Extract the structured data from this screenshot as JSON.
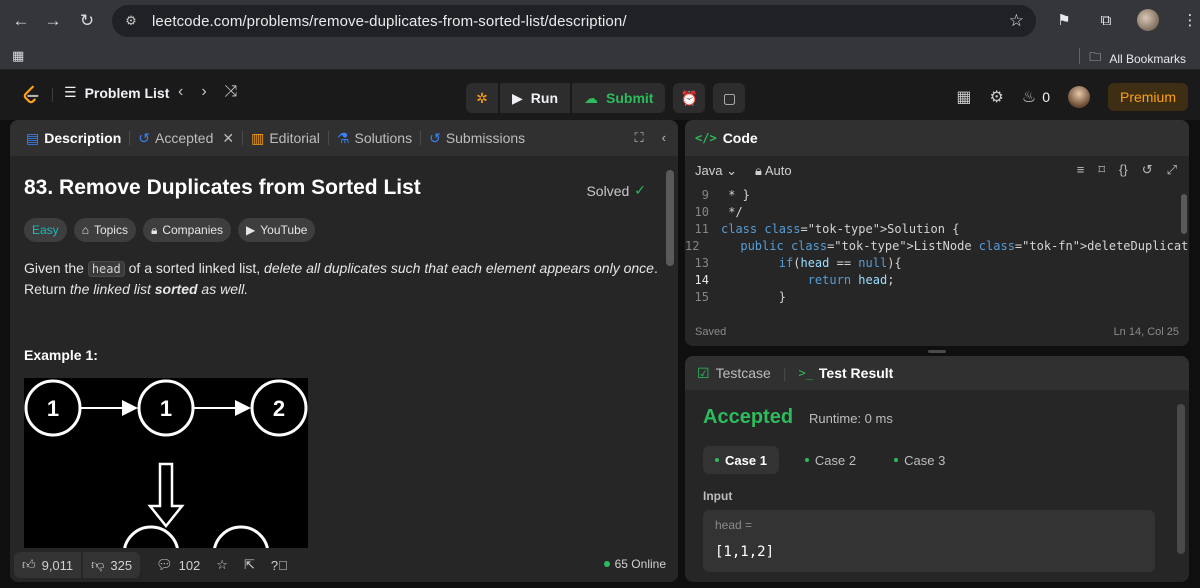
{
  "browser": {
    "url": "leetcode.com/problems/remove-duplicates-from-sorted-list/description/",
    "all_bookmarks": "All Bookmarks"
  },
  "nav": {
    "problem_list": "Problem List",
    "run": "Run",
    "submit": "Submit",
    "streak": "0",
    "premium": "Premium"
  },
  "tabs": {
    "description": "Description",
    "accepted": "Accepted",
    "editorial": "Editorial",
    "solutions": "Solutions",
    "submissions": "Submissions"
  },
  "problem": {
    "title": "83. Remove Duplicates from Sorted List",
    "status": "Solved",
    "difficulty": "Easy",
    "chips": [
      "Topics",
      "Companies",
      "YouTube"
    ],
    "desc_1": "Given the ",
    "desc_code": "head",
    "desc_2": " of a sorted linked list, ",
    "desc_em": "delete all duplicates such that each element appears only once",
    "desc_3": ". Return ",
    "desc_em2": "the linked list ",
    "desc_strong": "sorted",
    "desc_em3": " as well.",
    "example_title": "Example 1:",
    "nodes": [
      "1",
      "1",
      "2"
    ]
  },
  "footer": {
    "likes": "9,011",
    "dislikes": "325",
    "comments": "102",
    "online": "65 Online"
  },
  "code": {
    "title": "Code",
    "language": "Java",
    "mode": "Auto",
    "status": "Saved",
    "position": "Ln 14, Col 25",
    "lines": [
      {
        "n": "9",
        "t": " * }"
      },
      {
        "n": "10",
        "t": " */"
      },
      {
        "n": "11",
        "t": "class Solution {"
      },
      {
        "n": "12",
        "t": "    public ListNode deleteDuplicates(ListNode head) {"
      },
      {
        "n": "13",
        "t": "        if(head == null){"
      },
      {
        "n": "14",
        "t": "            return head;"
      },
      {
        "n": "15",
        "t": "        }"
      }
    ]
  },
  "test": {
    "testcase_tab": "Testcase",
    "result_tab": "Test Result",
    "verdict": "Accepted",
    "runtime": "Runtime: 0 ms",
    "cases": [
      "Case 1",
      "Case 2",
      "Case 3"
    ],
    "input_label": "Input",
    "input_var": "head =",
    "input_value": "[1,1,2]"
  },
  "colors": {
    "accent_green": "#2cbb5d",
    "premium_orange": "#ffa116",
    "easy_teal": "#1cbaba"
  }
}
